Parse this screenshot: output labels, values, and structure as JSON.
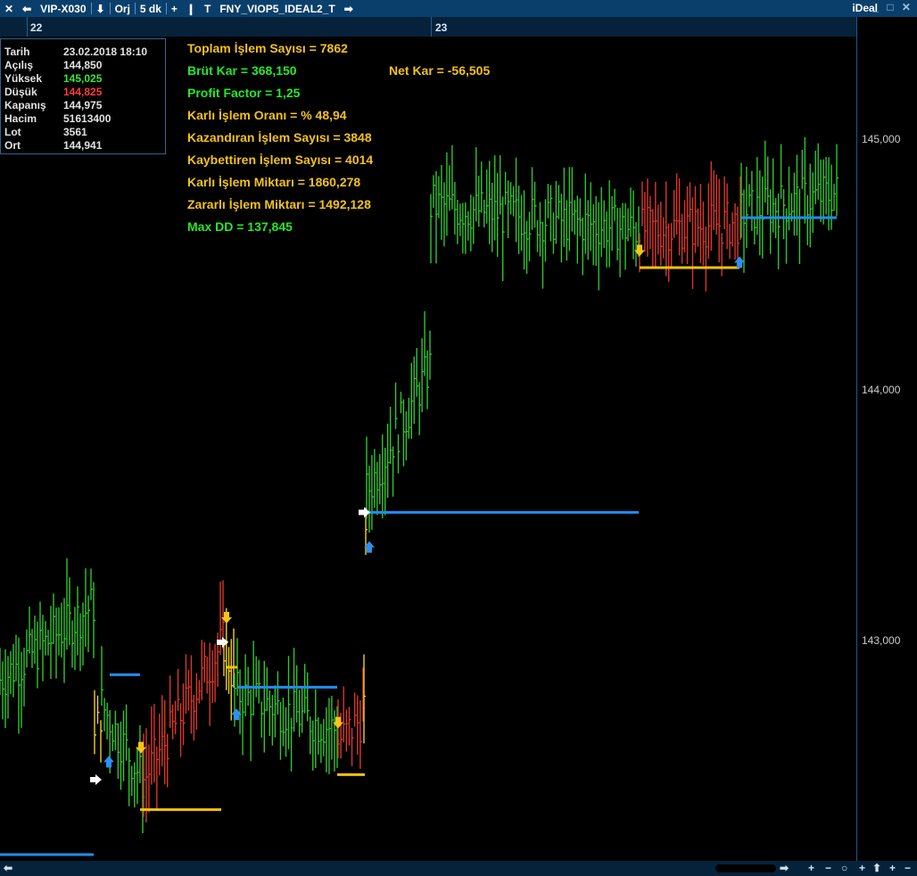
{
  "toolbar": {
    "close_glyph": "✕",
    "prev_glyph": "⬅",
    "symbol": "VIP-X030",
    "down_glyph": "⬇",
    "orj_label": "Orj",
    "period_label": "5 dk",
    "plus_glyph": "+",
    "bar_glyph": "❙",
    "t_glyph": "T",
    "system_name": "FNY_VIOP5_IDEAL2_T",
    "next_glyph": "➡",
    "brand": "iDeal",
    "window_controls": "_ □ ✕"
  },
  "date_axis": {
    "labels": [
      "22",
      "23"
    ]
  },
  "info_box": {
    "rows": [
      {
        "label": "Tarih",
        "value": "23.02.2018 18:10",
        "color": "#e2e2e2"
      },
      {
        "label": "Açılış",
        "value": "144,850",
        "color": "#e2e2e2"
      },
      {
        "label": "Yüksek",
        "value": "145,025",
        "color": "#39e639"
      },
      {
        "label": "Düşük",
        "value": "144,825",
        "color": "#ff3b3b"
      },
      {
        "label": "Kapanış",
        "value": "144,975",
        "color": "#e2e2e2"
      },
      {
        "label": "Hacim",
        "value": "51613400",
        "color": "#e2e2e2"
      },
      {
        "label": "Lot",
        "value": "3561",
        "color": "#e2e2e2"
      },
      {
        "label": "Ort",
        "value": "144,941",
        "color": "#e2e2e2"
      }
    ]
  },
  "stats": {
    "total_trades": "Toplam İşlem Sayısı =  7862",
    "gross_profit": "Brüt Kar =  368,150",
    "net_profit": "Net Kar =  -56,505",
    "profit_factor": "Profit Factor =  1,25",
    "win_rate": "Karlı İşlem Oranı = % 48,94",
    "winning_trades": "Kazandıran İşlem Sayısı =  3848",
    "losing_trades": "Kaybettiren İşlem Sayısı =  4014",
    "profit_amount": "Karlı İşlem Miktarı =  1860,278",
    "loss_amount": "Zararlı İşlem Miktarı =  1492,128",
    "max_dd": "Max DD = 137,845"
  },
  "colors": {
    "stat_yellow": "#f2c21a",
    "stat_green": "#27e827",
    "bar_green": "#2fc52f",
    "bar_red": "#d8382a",
    "bar_yellow": "#f0d020",
    "level_blue": "#1f8ef0",
    "level_yellow": "#f4c20d"
  },
  "bottom_controls": {
    "left_arrow": "⬅",
    "scroll_arrow": "➡",
    "zoom_in": "+",
    "zoom_out": "−",
    "reset": "○",
    "v_plus": "+",
    "v_up": "⬆",
    "v_add": "+",
    "v_minus": "−"
  },
  "chart_data": {
    "type": "ohlc",
    "y_ticks": [
      "145,000",
      "144,000",
      "143,000"
    ],
    "ylim": [
      142.225,
      145.525
    ],
    "session_labels": [
      "22",
      "23"
    ],
    "segments": [
      {
        "x0": 0,
        "x1": 105,
        "c0": 142.95,
        "c1": 143.25,
        "color": "green"
      },
      {
        "x0": 106,
        "x1": 113,
        "c0": 142.7,
        "c1": 142.82,
        "color": "yellow"
      },
      {
        "x0": 114,
        "x1": 160,
        "c0": 142.85,
        "c1": 142.55,
        "color": "green"
      },
      {
        "x0": 161,
        "x1": 250,
        "c0": 142.55,
        "c1": 143.1,
        "color": "red"
      },
      {
        "x0": 251,
        "x1": 262,
        "c0": 143.1,
        "c1": 142.95,
        "color": "yellow"
      },
      {
        "x0": 263,
        "x1": 378,
        "c0": 142.9,
        "c1": 142.75,
        "color": "green"
      },
      {
        "x0": 379,
        "x1": 407,
        "c0": 142.7,
        "c1": 142.8,
        "color": "red"
      },
      {
        "x0": 408,
        "x1": 410,
        "c0": 142.8,
        "c1": 143.6,
        "color": "yellow"
      },
      {
        "x0": 411,
        "x1": 482,
        "c0": 143.7,
        "c1": 144.2,
        "color": "green"
      },
      {
        "x0": 483,
        "x1": 716,
        "c0": 144.85,
        "c1": 144.75,
        "color": "green"
      },
      {
        "x0": 717,
        "x1": 830,
        "c0": 144.75,
        "c1": 144.78,
        "color": "red"
      },
      {
        "x0": 831,
        "x1": 938,
        "c0": 144.82,
        "c1": 144.9,
        "color": "green"
      }
    ],
    "levels": [
      {
        "x0": 0,
        "x1": 105,
        "y": 142.25,
        "color": "blue"
      },
      {
        "x0": 123,
        "x1": 157,
        "y": 142.97,
        "color": "blue"
      },
      {
        "x0": 157,
        "x1": 248,
        "y": 142.43,
        "color": "yellow"
      },
      {
        "x0": 253,
        "x1": 266,
        "y": 143.0,
        "color": "yellow"
      },
      {
        "x0": 266,
        "x1": 378,
        "y": 142.92,
        "color": "blue"
      },
      {
        "x0": 378,
        "x1": 409,
        "y": 142.57,
        "color": "yellow"
      },
      {
        "x0": 414,
        "x1": 716,
        "y": 143.62,
        "color": "blue"
      },
      {
        "x0": 717,
        "x1": 829,
        "y": 144.6,
        "color": "yellow"
      },
      {
        "x0": 831,
        "x1": 938,
        "y": 144.8,
        "color": "blue"
      }
    ],
    "signals": [
      {
        "x": 107,
        "y": 142.55,
        "kind": "exit"
      },
      {
        "x": 122,
        "y": 142.62,
        "kind": "buy"
      },
      {
        "x": 158,
        "y": 142.68,
        "kind": "sell"
      },
      {
        "x": 254,
        "y": 143.2,
        "kind": "sell"
      },
      {
        "x": 249,
        "y": 143.1,
        "kind": "exit"
      },
      {
        "x": 265,
        "y": 142.81,
        "kind": "buy"
      },
      {
        "x": 379,
        "y": 142.78,
        "kind": "sell"
      },
      {
        "x": 408,
        "y": 143.62,
        "kind": "exit"
      },
      {
        "x": 414,
        "y": 143.48,
        "kind": "buy"
      },
      {
        "x": 717,
        "y": 144.67,
        "kind": "sell"
      },
      {
        "x": 829,
        "y": 144.62,
        "kind": "buy"
      }
    ]
  }
}
